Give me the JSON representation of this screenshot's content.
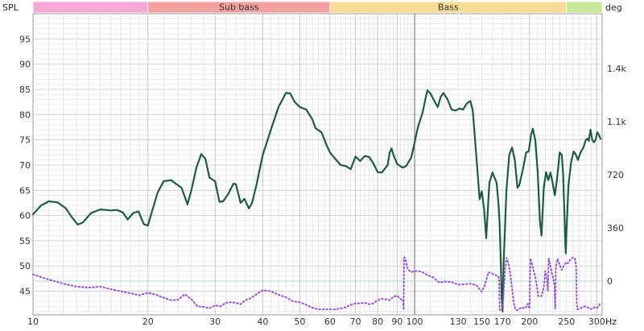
{
  "chart_data": {
    "type": "line",
    "x_scale": "log",
    "xlim": [
      10,
      310
    ],
    "x_ticks": [
      10,
      20,
      30,
      40,
      50,
      60,
      70,
      80,
      90,
      100,
      130,
      150,
      170,
      200,
      250,
      300
    ],
    "x_tick_labels": [
      "10",
      "20",
      "30",
      "40",
      "50",
      "60",
      "70",
      "80",
      "90",
      "100",
      "130",
      "150",
      "170",
      "200",
      "250",
      "300"
    ],
    "x_unit": "Hz",
    "ylim": [
      40.3,
      100
    ],
    "y_ticks": [
      45,
      50,
      55,
      60,
      65,
      70,
      75,
      80,
      85,
      90,
      95
    ],
    "y_tick_labels": [
      "45",
      "50",
      "55",
      "60",
      "65",
      "70",
      "75",
      "80",
      "85",
      "90",
      "95"
    ],
    "y_title": "SPL",
    "y2_title": "deg",
    "y2_ticks": [
      0,
      360,
      720,
      1080,
      1440
    ],
    "y2_tick_labels": [
      "0",
      "360",
      "720",
      "1.1k",
      "1.4k"
    ],
    "grid": true,
    "bands": [
      {
        "label": "",
        "from": 10,
        "to": 20,
        "color": "#f7a8d8"
      },
      {
        "label": "Sub bass",
        "from": 20,
        "to": 60,
        "color": "#f4a0a0"
      },
      {
        "label": "Bass",
        "from": 60,
        "to": 250,
        "color": "#f8dc96"
      },
      {
        "label": "",
        "from": 250,
        "to": 310,
        "color": "#c8e89a"
      }
    ],
    "series": [
      {
        "color": "#1a5e3c",
        "points": [
          [
            10,
            60.2
          ],
          [
            10.5,
            62
          ],
          [
            11,
            62.8
          ],
          [
            11.6,
            62.6
          ],
          [
            12.2,
            61.4
          ],
          [
            12.6,
            59.8
          ],
          [
            13.1,
            58.2
          ],
          [
            13.5,
            58.6
          ],
          [
            14.2,
            60.5
          ],
          [
            15,
            61.2
          ],
          [
            16,
            61
          ],
          [
            16.6,
            61.1
          ],
          [
            17.2,
            60.6
          ],
          [
            17.7,
            59.2
          ],
          [
            18.3,
            60.5
          ],
          [
            18.9,
            60.8
          ],
          [
            19.5,
            58.3
          ],
          [
            20,
            58
          ],
          [
            20.5,
            60.8
          ],
          [
            21.2,
            64.5
          ],
          [
            22,
            66.8
          ],
          [
            23,
            67
          ],
          [
            24.5,
            65.5
          ],
          [
            25.4,
            62.2
          ],
          [
            26,
            65
          ],
          [
            26.8,
            69.5
          ],
          [
            27.6,
            72.2
          ],
          [
            28.3,
            71.2
          ],
          [
            29,
            67.5
          ],
          [
            30,
            66.8
          ],
          [
            30.8,
            62.7
          ],
          [
            31.5,
            62.8
          ],
          [
            32.5,
            64.3
          ],
          [
            33.5,
            66.3
          ],
          [
            34,
            66.2
          ],
          [
            35,
            62.5
          ],
          [
            35.8,
            63.3
          ],
          [
            36.8,
            61.4
          ],
          [
            37.5,
            62.5
          ],
          [
            38.5,
            66
          ],
          [
            40,
            72
          ],
          [
            42,
            77
          ],
          [
            44,
            81.5
          ],
          [
            46,
            84.3
          ],
          [
            47.2,
            84.2
          ],
          [
            48.5,
            82.5
          ],
          [
            50,
            81.5
          ],
          [
            52,
            81
          ],
          [
            54,
            79
          ],
          [
            55,
            77.3
          ],
          [
            57,
            76.5
          ],
          [
            59,
            73.7
          ],
          [
            60,
            72.5
          ],
          [
            62,
            71.2
          ],
          [
            64,
            70
          ],
          [
            66,
            69.8
          ],
          [
            68,
            69.2
          ],
          [
            70,
            71.7
          ],
          [
            72,
            70.8
          ],
          [
            74,
            71.8
          ],
          [
            76,
            71.6
          ],
          [
            78,
            70.3
          ],
          [
            80,
            68.6
          ],
          [
            82,
            68.5
          ],
          [
            83,
            69
          ],
          [
            85,
            70
          ],
          [
            86,
            72.5
          ],
          [
            87,
            73.3
          ],
          [
            88,
            72
          ],
          [
            90,
            70.2
          ],
          [
            93,
            69.5
          ],
          [
            95,
            69.8
          ],
          [
            98,
            71.5
          ],
          [
            100,
            74.5
          ],
          [
            102,
            77.5
          ],
          [
            105,
            80.5
          ],
          [
            107,
            83.5
          ],
          [
            108,
            84.8
          ],
          [
            110,
            84.2
          ],
          [
            113,
            82.5
          ],
          [
            115,
            81.5
          ],
          [
            117,
            83.5
          ],
          [
            119,
            84.3
          ],
          [
            122,
            83
          ],
          [
            125,
            81
          ],
          [
            128,
            80.8
          ],
          [
            131,
            81.2
          ],
          [
            134,
            81
          ],
          [
            137,
            82.2
          ],
          [
            140,
            82.7
          ],
          [
            142,
            80.8
          ],
          [
            145,
            72
          ],
          [
            148,
            63.2
          ],
          [
            150,
            64.8
          ],
          [
            152,
            61.3
          ],
          [
            154,
            55.5
          ],
          [
            157,
            66.5
          ],
          [
            160,
            68.5
          ],
          [
            164,
            66.5
          ],
          [
            166,
            62
          ],
          [
            167,
            58.5
          ],
          [
            168,
            52
          ],
          [
            169,
            44
          ],
          [
            170,
            41
          ],
          [
            171,
            50
          ],
          [
            174,
            65
          ],
          [
            177,
            72
          ],
          [
            180,
            73.5
          ],
          [
            183,
            71
          ],
          [
            186,
            65.5
          ],
          [
            188,
            66
          ],
          [
            192,
            69
          ],
          [
            196,
            72.5
          ],
          [
            199,
            72.7
          ],
          [
            202,
            76
          ],
          [
            204,
            77.2
          ],
          [
            207,
            75
          ],
          [
            210,
            69
          ],
          [
            213,
            59
          ],
          [
            215,
            56
          ],
          [
            218,
            65.5
          ],
          [
            221,
            68.6
          ],
          [
            224,
            67
          ],
          [
            227,
            68.5
          ],
          [
            230,
            66.5
          ],
          [
            233,
            64
          ],
          [
            236,
            67
          ],
          [
            240,
            72.5
          ],
          [
            243,
            72
          ],
          [
            245,
            68
          ],
          [
            247,
            60
          ],
          [
            248,
            55
          ],
          [
            249,
            52.5
          ],
          [
            250,
            57
          ],
          [
            253,
            66
          ],
          [
            257,
            70.5
          ],
          [
            261,
            72.7
          ],
          [
            264,
            72.2
          ],
          [
            268,
            71
          ],
          [
            272,
            72.5
          ],
          [
            277,
            73.5
          ],
          [
            281,
            75
          ],
          [
            284,
            75.2
          ],
          [
            286,
            74.8
          ],
          [
            289,
            77
          ],
          [
            292,
            75
          ],
          [
            295,
            74.5
          ],
          [
            298,
            75
          ],
          [
            301,
            76.5
          ],
          [
            304,
            76
          ],
          [
            307,
            75.2
          ]
        ]
      },
      {
        "style": "dotted",
        "color": "#9b4fe0",
        "points": [
          [
            10,
            48.3
          ],
          [
            11,
            47.3
          ],
          [
            12,
            46.5
          ],
          [
            13,
            45.9
          ],
          [
            14,
            45.7
          ],
          [
            15,
            45.9
          ],
          [
            16,
            45.4
          ],
          [
            17,
            45
          ],
          [
            18,
            44.6
          ],
          [
            19,
            44.2
          ],
          [
            20,
            44.7
          ],
          [
            21,
            44.3
          ],
          [
            22,
            43.7
          ],
          [
            23,
            43.2
          ],
          [
            24,
            43.3
          ],
          [
            25,
            44.4
          ],
          [
            26,
            43.4
          ],
          [
            27,
            42
          ],
          [
            28,
            41.9
          ],
          [
            29,
            41.6
          ],
          [
            30,
            42.2
          ],
          [
            31,
            42
          ],
          [
            32,
            42.7
          ],
          [
            33,
            42.8
          ],
          [
            34,
            42.7
          ],
          [
            35,
            42.4
          ],
          [
            36,
            43.2
          ],
          [
            37,
            43.5
          ],
          [
            38,
            44.1
          ],
          [
            40,
            45.2
          ],
          [
            42,
            45
          ],
          [
            44,
            44.3
          ],
          [
            46,
            43.8
          ],
          [
            48,
            43
          ],
          [
            50,
            42.8
          ],
          [
            52,
            42.3
          ],
          [
            54,
            41.7
          ],
          [
            56,
            41.4
          ],
          [
            58,
            41.4
          ],
          [
            60,
            41.4
          ],
          [
            62,
            41.4
          ],
          [
            64,
            41.6
          ],
          [
            66,
            41.8
          ],
          [
            68,
            42.3
          ],
          [
            70,
            42.6
          ],
          [
            72,
            42.6
          ],
          [
            74,
            42.7
          ],
          [
            76,
            42.4
          ],
          [
            78,
            42.6
          ],
          [
            80,
            43.2
          ],
          [
            82,
            43.5
          ],
          [
            84,
            43.4
          ],
          [
            86,
            43.2
          ],
          [
            88,
            43.9
          ],
          [
            90,
            44.1
          ],
          [
            92,
            43.4
          ],
          [
            93.3,
            43.3
          ],
          [
            93.6,
            41.3
          ],
          [
            93.8,
            51.7
          ],
          [
            94.5,
            51.5
          ],
          [
            96,
            49.3
          ],
          [
            98,
            48.8
          ],
          [
            101,
            49
          ],
          [
            104,
            48.9
          ],
          [
            108,
            48.2
          ],
          [
            112,
            47.7
          ],
          [
            116,
            46.7
          ],
          [
            120,
            46.9
          ],
          [
            125,
            46.8
          ],
          [
            130,
            46.3
          ],
          [
            135,
            46.4
          ],
          [
            140,
            46.5
          ],
          [
            145,
            46.2
          ],
          [
            148,
            45.4
          ],
          [
            150,
            44.9
          ],
          [
            153,
            46.3
          ],
          [
            156,
            48.7
          ],
          [
            159,
            48.6
          ],
          [
            162,
            48.2
          ],
          [
            165,
            48.1
          ],
          [
            166.5,
            47.5
          ],
          [
            167,
            41.5
          ],
          [
            168,
            41.2
          ],
          [
            169.5,
            41.5
          ],
          [
            171,
            44
          ],
          [
            172.5,
            49
          ],
          [
            174,
            51.6
          ],
          [
            176,
            50.6
          ],
          [
            178,
            48.5
          ],
          [
            180,
            45.5
          ],
          [
            182,
            42.5
          ],
          [
            184,
            41.3
          ],
          [
            186,
            41.2
          ],
          [
            188,
            41.5
          ],
          [
            190,
            41.7
          ],
          [
            192,
            41.6
          ],
          [
            194,
            41.9
          ],
          [
            196,
            41.8
          ],
          [
            198,
            42.5
          ],
          [
            200,
            41.5
          ],
          [
            201,
            51.5
          ],
          [
            203,
            50.5
          ],
          [
            205,
            49
          ],
          [
            207,
            48
          ],
          [
            209,
            46
          ],
          [
            211,
            44
          ],
          [
            213,
            44
          ],
          [
            215,
            44
          ],
          [
            218,
            45.8
          ],
          [
            220,
            49
          ],
          [
            222,
            47.5
          ],
          [
            223.5,
            45
          ],
          [
            224.5,
            51.5
          ],
          [
            227,
            50
          ],
          [
            229,
            48.5
          ],
          [
            231,
            47.5
          ],
          [
            232.5,
            46
          ],
          [
            233.5,
            41.5
          ],
          [
            234.5,
            50
          ],
          [
            237,
            51.4
          ],
          [
            240,
            50.2
          ],
          [
            243,
            49.2
          ],
          [
            246,
            50
          ],
          [
            249,
            50.7
          ],
          [
            252,
            50.5
          ],
          [
            256,
            51.3
          ],
          [
            260,
            51.7
          ],
          [
            263,
            51.5
          ],
          [
            265,
            50
          ],
          [
            266,
            42.8
          ],
          [
            267,
            41.4
          ],
          [
            270,
            41.5
          ],
          [
            275,
            41.8
          ],
          [
            280,
            42
          ],
          [
            284,
            41.8
          ],
          [
            288,
            41.5
          ],
          [
            292,
            41.5
          ],
          [
            296,
            41.8
          ],
          [
            300,
            41.6
          ],
          [
            304,
            42.1
          ],
          [
            307,
            42.8
          ]
        ]
      }
    ]
  }
}
